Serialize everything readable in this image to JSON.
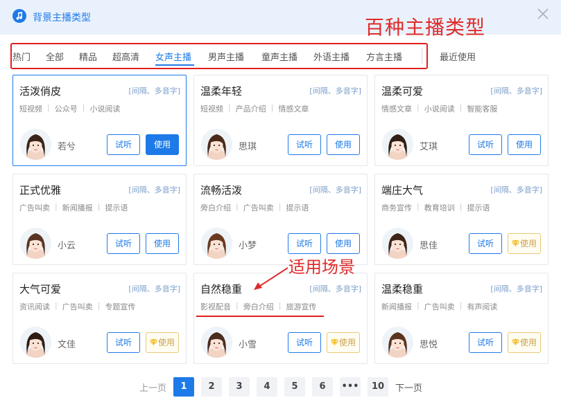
{
  "dialog": {
    "title": "背景主播类型"
  },
  "annotations": {
    "title_note": "百种主播类型",
    "scene_note": "适用场景"
  },
  "tabs": [
    {
      "label": "热门",
      "active": false
    },
    {
      "label": "全部",
      "active": false
    },
    {
      "label": "精品",
      "active": false
    },
    {
      "label": "超高清",
      "active": false
    },
    {
      "label": "女声主播",
      "active": true
    },
    {
      "label": "男声主播",
      "active": false
    },
    {
      "label": "童声主播",
      "active": false
    },
    {
      "label": "外语主播",
      "active": false
    },
    {
      "label": "方言主播",
      "active": false
    },
    {
      "label": "最近使用",
      "active": false
    }
  ],
  "cards": [
    {
      "name": "活泼俏皮",
      "hint": "[间隔、多音字]",
      "tags": [
        "短视频",
        "公众号",
        "小说阅读"
      ],
      "speaker": "若兮",
      "listen_label": "试听",
      "use_label": "使用",
      "use_style": "primary",
      "selected": true
    },
    {
      "name": "温柔年轻",
      "hint": "[间隔、多音字]",
      "tags": [
        "短视频",
        "产品介绍",
        "情感文章"
      ],
      "speaker": "思琪",
      "listen_label": "试听",
      "use_label": "使用",
      "use_style": "normal",
      "selected": false
    },
    {
      "name": "温柔可爱",
      "hint": "[间隔、多音字]",
      "tags": [
        "情感文章",
        "小说阅读",
        "智能客服"
      ],
      "speaker": "艾琪",
      "listen_label": "试听",
      "use_label": "使用",
      "use_style": "normal",
      "selected": false
    },
    {
      "name": "正式优雅",
      "hint": "[间隔、多音字]",
      "tags": [
        "广告叫卖",
        "新闻播报",
        "提示语"
      ],
      "speaker": "小云",
      "listen_label": "试听",
      "use_label": "使用",
      "use_style": "normal",
      "selected": false
    },
    {
      "name": "流畅活泼",
      "hint": "[间隔、多音字]",
      "tags": [
        "旁白介绍",
        "广告叫卖",
        "提示语"
      ],
      "speaker": "小梦",
      "listen_label": "试听",
      "use_label": "使用",
      "use_style": "normal",
      "selected": false
    },
    {
      "name": "端庄大气",
      "hint": "[间隔、多音字]",
      "tags": [
        "商务宣传",
        "教育培训",
        "提示语"
      ],
      "speaker": "思佳",
      "listen_label": "试听",
      "use_label": "使用",
      "use_style": "vip",
      "selected": false
    },
    {
      "name": "大气可爱",
      "hint": "[间隔、多音字]",
      "tags": [
        "资讯阅读",
        "广告叫卖",
        "专题宣传"
      ],
      "speaker": "文佳",
      "listen_label": "试听",
      "use_label": "使用",
      "use_style": "vip",
      "selected": false
    },
    {
      "name": "自然稳重",
      "hint": "[间隔、多音字]",
      "tags": [
        "影视配音",
        "旁白介绍",
        "旅游宣传"
      ],
      "speaker": "小雪",
      "listen_label": "试听",
      "use_label": "使用",
      "use_style": "vip",
      "selected": false
    },
    {
      "name": "温柔稳重",
      "hint": "[间隔、多音字]",
      "tags": [
        "新闻播报",
        "广告叫卖",
        "有声阅读"
      ],
      "speaker": "思悦",
      "listen_label": "试听",
      "use_label": "使用",
      "use_style": "vip",
      "selected": false
    }
  ],
  "pagination": {
    "prev_label": "上一页",
    "next_label": "下一页",
    "pages": [
      "1",
      "2",
      "3",
      "4",
      "5",
      "6",
      "•••",
      "10"
    ],
    "current": "1"
  },
  "colors": {
    "accent": "#1e7ae8",
    "annotation": "#e11e1e",
    "vip": "#e9c979"
  }
}
